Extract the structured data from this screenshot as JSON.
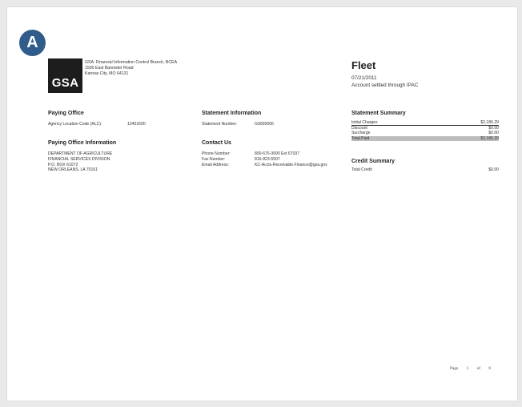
{
  "badge": {
    "letter": "A"
  },
  "logo": {
    "text": "GSA"
  },
  "org": {
    "line1": "GSA: Financial Information Control Branch, BCEA",
    "line2": "1500 East Bannister Road",
    "line3": "Kansas City, MO 64131"
  },
  "header": {
    "title": "Fleet",
    "date": "07/21/2011",
    "status": "Account settled through IPAC"
  },
  "paying_office": {
    "title": "Paying Office",
    "alc_label": "Agency Location Code (ALC):",
    "alc_value": "12401600"
  },
  "statement_info": {
    "title": "Statement Information",
    "number_label": "Statement Number:",
    "number_value": "G0000006"
  },
  "statement_summary": {
    "title": "Statement Summary",
    "rows": [
      {
        "label": "Initial Charges",
        "value": "$2,186.29"
      },
      {
        "label": "Discount",
        "value": "$0.00"
      },
      {
        "label": "Surcharge",
        "value": "$0.00"
      },
      {
        "label": "Total Paid",
        "value": "$2,186.29"
      }
    ]
  },
  "paying_office_info": {
    "title": "Paying Office Information",
    "lines": [
      "DEPARTMENT OF AGRICULTURE",
      "FINANCIAL SERVICES DIVISION",
      "P.O. BOX 61072",
      "NEW ORLEANS, LA 70161"
    ]
  },
  "contact": {
    "title": "Contact Us",
    "phone_label": "Phone Number:",
    "phone_value": "800-676-3690 Ext 67037",
    "fax_label": "Fax Number:",
    "fax_value": "816-823-5507",
    "email_label": "Email Address:",
    "email_value": "KC-Accts-Receivable.Finance@gsa.gov"
  },
  "credit_summary": {
    "title": "Credit Summary",
    "label": "Total Credit",
    "value": "$0.00"
  },
  "footer": {
    "page_label": "Page",
    "page_num": "1",
    "of_label": "of",
    "total_pages": "6"
  }
}
